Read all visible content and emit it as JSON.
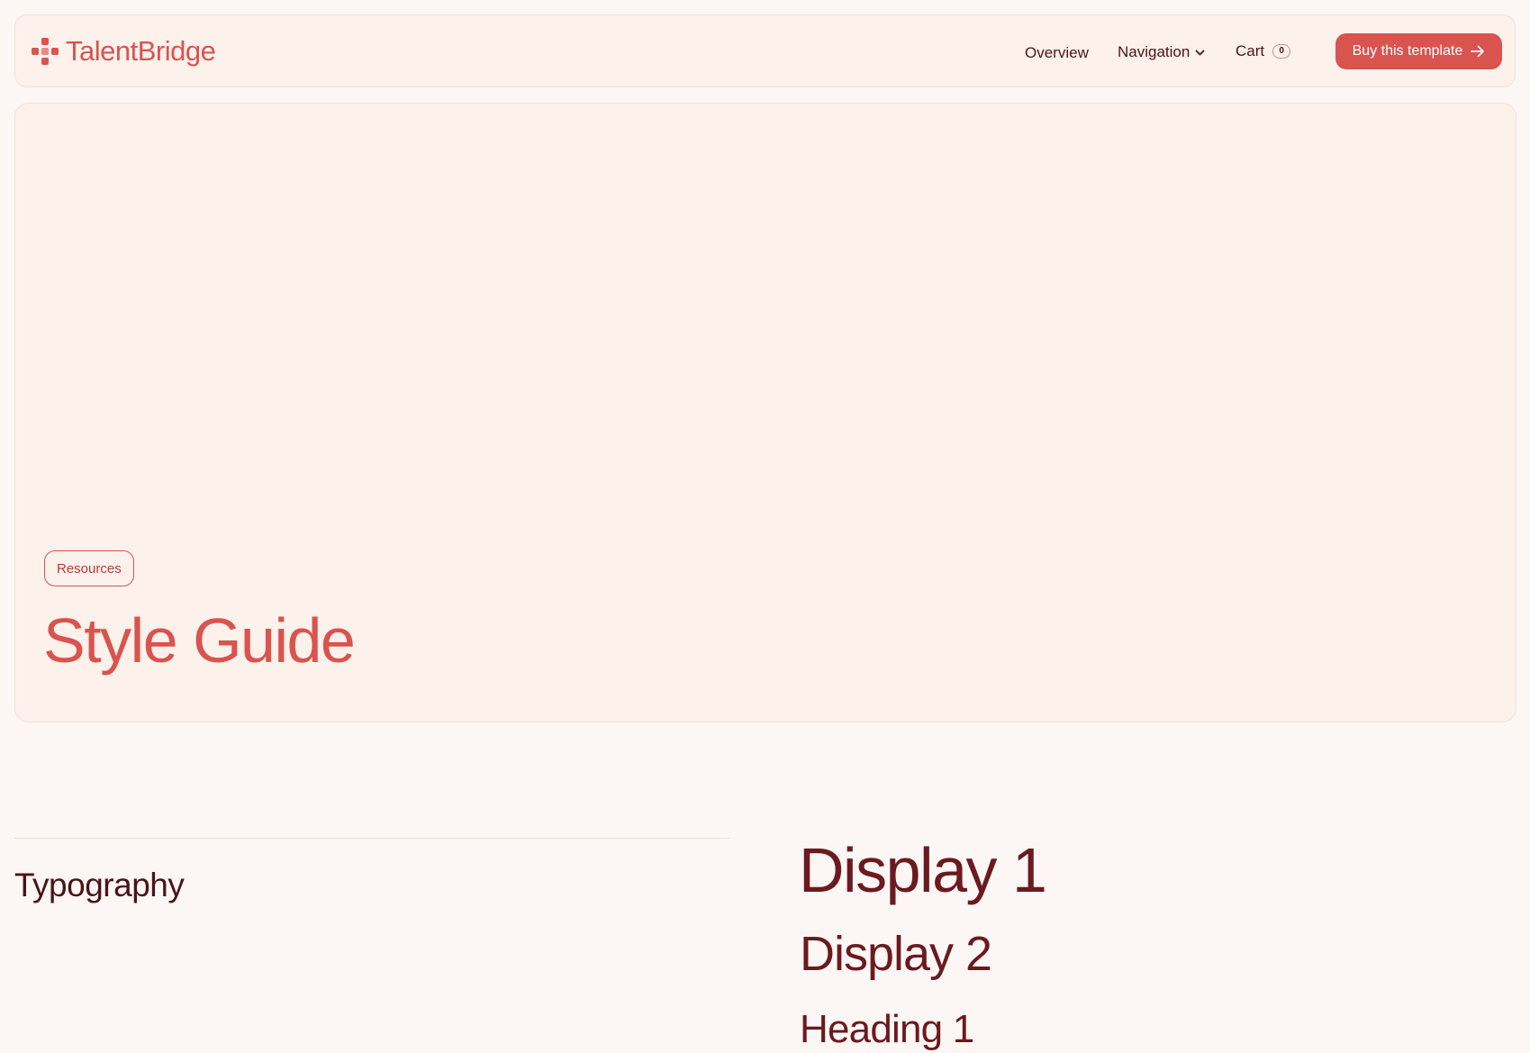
{
  "header": {
    "brand": "TalentBridge",
    "nav": {
      "overview": "Overview",
      "navigation": "Navigation",
      "cart": "Cart",
      "cart_count": "0"
    },
    "cta_label": "Buy this template",
    "logo_icon": "cross-dots-logo-icon",
    "arrow_icon": "arrow-right-icon",
    "chevron_icon": "chevron-down-icon"
  },
  "hero": {
    "tag": "Resources",
    "title": "Style Guide"
  },
  "typography": {
    "section_title": "Typography",
    "samples": {
      "display_1": "Display 1",
      "display_2": "Display 2",
      "heading_1": "Heading 1"
    }
  },
  "colors": {
    "accent": "#d9534f",
    "text_dark": "#6b1a1f",
    "surface": "#fdf1ec",
    "page_background": "#fcf7f4"
  }
}
